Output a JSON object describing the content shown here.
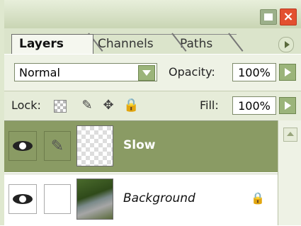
{
  "tabs": [
    "Layers",
    "Channels",
    "Paths"
  ],
  "blend_mode": "Normal",
  "opacity": {
    "label": "Opacity:",
    "value": "100%"
  },
  "lock": {
    "label": "Lock:"
  },
  "fill": {
    "label": "Fill:",
    "value": "100%"
  },
  "layers": [
    {
      "name": "Slow",
      "selected": true,
      "visible": true
    },
    {
      "name": "Background",
      "selected": false,
      "visible": true,
      "locked": true
    }
  ],
  "colors": {
    "selected_row": "#8a9b64",
    "accent": "#9bb47a",
    "close": "#e35030"
  }
}
